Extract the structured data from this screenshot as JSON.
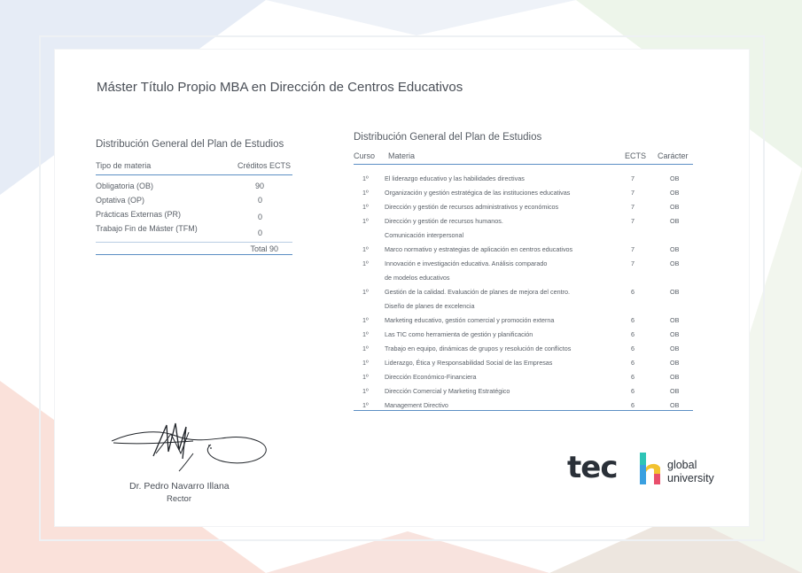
{
  "document": {
    "title": "Máster Título Propio MBA en Dirección de Centros Educativos"
  },
  "summary_table": {
    "title": "Distribución General del Plan de Estudios",
    "header": {
      "type": "Tipo de materia",
      "credits": "Créditos ECTS"
    },
    "rows": [
      {
        "label": "Obligatoria (OB)",
        "value": "90"
      },
      {
        "label": "Optativa (OP)",
        "value": "0"
      },
      {
        "label": "Prácticas Externas (PR)",
        "value": "0"
      },
      {
        "label": "Trabajo Fin de Máster (TFM)",
        "value": "0"
      }
    ],
    "total": "Total 90"
  },
  "course_table": {
    "title": "Distribución General del Plan de Estudios",
    "header": {
      "curso": "Curso",
      "materia": "Materia",
      "ects": "ECTS",
      "caracter": "Carácter"
    },
    "rows": [
      {
        "curso": "1º",
        "materia": "El liderazgo educativo y las habilidades directivas",
        "ects": "7",
        "caracter": "OB"
      },
      {
        "curso": "1º",
        "materia": "Organización y gestión estratégica de las instituciones educativas",
        "ects": "7",
        "caracter": "OB"
      },
      {
        "curso": "1º",
        "materia": "Dirección y gestión de recursos administrativos y económicos",
        "ects": "7",
        "caracter": "OB"
      },
      {
        "curso": "1º",
        "materia": "Dirección y gestión de recursos humanos.",
        "ects": "7",
        "caracter": "OB"
      },
      {
        "curso": "",
        "materia": "Comunicación interpersonal",
        "ects": "",
        "caracter": ""
      },
      {
        "curso": "1º",
        "materia": "Marco normativo y estrategias de aplicación en centros educativos",
        "ects": "7",
        "caracter": "OB"
      },
      {
        "curso": "1º",
        "materia": "Innovación e investigación educativa. Análisis comparado",
        "ects": "7",
        "caracter": "OB"
      },
      {
        "curso": "",
        "materia": "de modelos educativos",
        "ects": "",
        "caracter": ""
      },
      {
        "curso": "1º",
        "materia": "Gestión de la calidad. Evaluación de planes de mejora del centro.",
        "ects": "6",
        "caracter": "OB"
      },
      {
        "curso": "",
        "materia": "Diseño de planes de excelencia",
        "ects": "",
        "caracter": ""
      },
      {
        "curso": "1º",
        "materia": "Marketing educativo, gestión comercial y promoción externa",
        "ects": "6",
        "caracter": "OB"
      },
      {
        "curso": "1º",
        "materia": "Las TIC como herramienta de gestión y planificación",
        "ects": "6",
        "caracter": "OB"
      },
      {
        "curso": "1º",
        "materia": "Trabajo en equipo, dinámicas de grupos y resolución de conflictos",
        "ects": "6",
        "caracter": "OB"
      },
      {
        "curso": "1º",
        "materia": "Liderazgo, Ética y Responsabilidad Social de las Empresas",
        "ects": "6",
        "caracter": "OB"
      },
      {
        "curso": "1º",
        "materia": "Dirección Económico-Financiera",
        "ects": "6",
        "caracter": "OB"
      },
      {
        "curso": "1º",
        "materia": "Dirección Comercial y Marketing Estratégico",
        "ects": "6",
        "caracter": "OB"
      },
      {
        "curso": "1º",
        "materia": "Management Directivo",
        "ects": "6",
        "caracter": "OB"
      }
    ]
  },
  "signature": {
    "name": "Dr. Pedro Navarro Illana",
    "role": "Rector"
  },
  "logo": {
    "word": "tec",
    "letter_h": "h",
    "line1": "global",
    "line2": "university",
    "colors": [
      "#2ec4b6",
      "#3aa0e0",
      "#f2c230",
      "#e94e6b"
    ]
  },
  "colors": {
    "rule": "#5c8fc4",
    "text": "#4a4f57"
  }
}
